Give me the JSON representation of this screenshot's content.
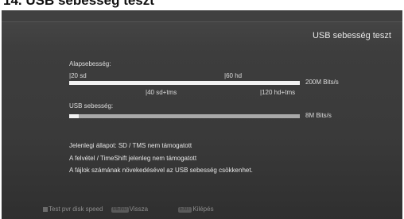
{
  "doc_heading": "14. USB sebesség teszt",
  "screen_title": "USB sebesség teszt",
  "base_speed": {
    "label": "Alapsebesség:",
    "ticks_top": [
      "|20 sd",
      "|60 hd"
    ],
    "ticks_bottom": [
      "|40 sd+tms",
      "|120 hd+tms"
    ],
    "value_label": "200M Bits/s",
    "fill_fraction": 1.0
  },
  "usb_speed": {
    "label": "USB sebesség:",
    "value_label": "8M Bits/s",
    "fill_fraction": 0.04
  },
  "info_lines": [
    "Jelenlegi állapot: SD / TMS nem támogatott",
    "A felvétel / TimeShift jelenleg nem támogatott",
    "A fájlok számának növekedésével az USB sebesség csökkenhet."
  ],
  "footer": {
    "test_label": "Test pvr disk speed",
    "menu_key": "MENU",
    "back_label": "Vissza",
    "exit_key": "EXIT",
    "exit_label": "Kilépés"
  },
  "colors": {
    "test_square": "#6a6a6a"
  }
}
